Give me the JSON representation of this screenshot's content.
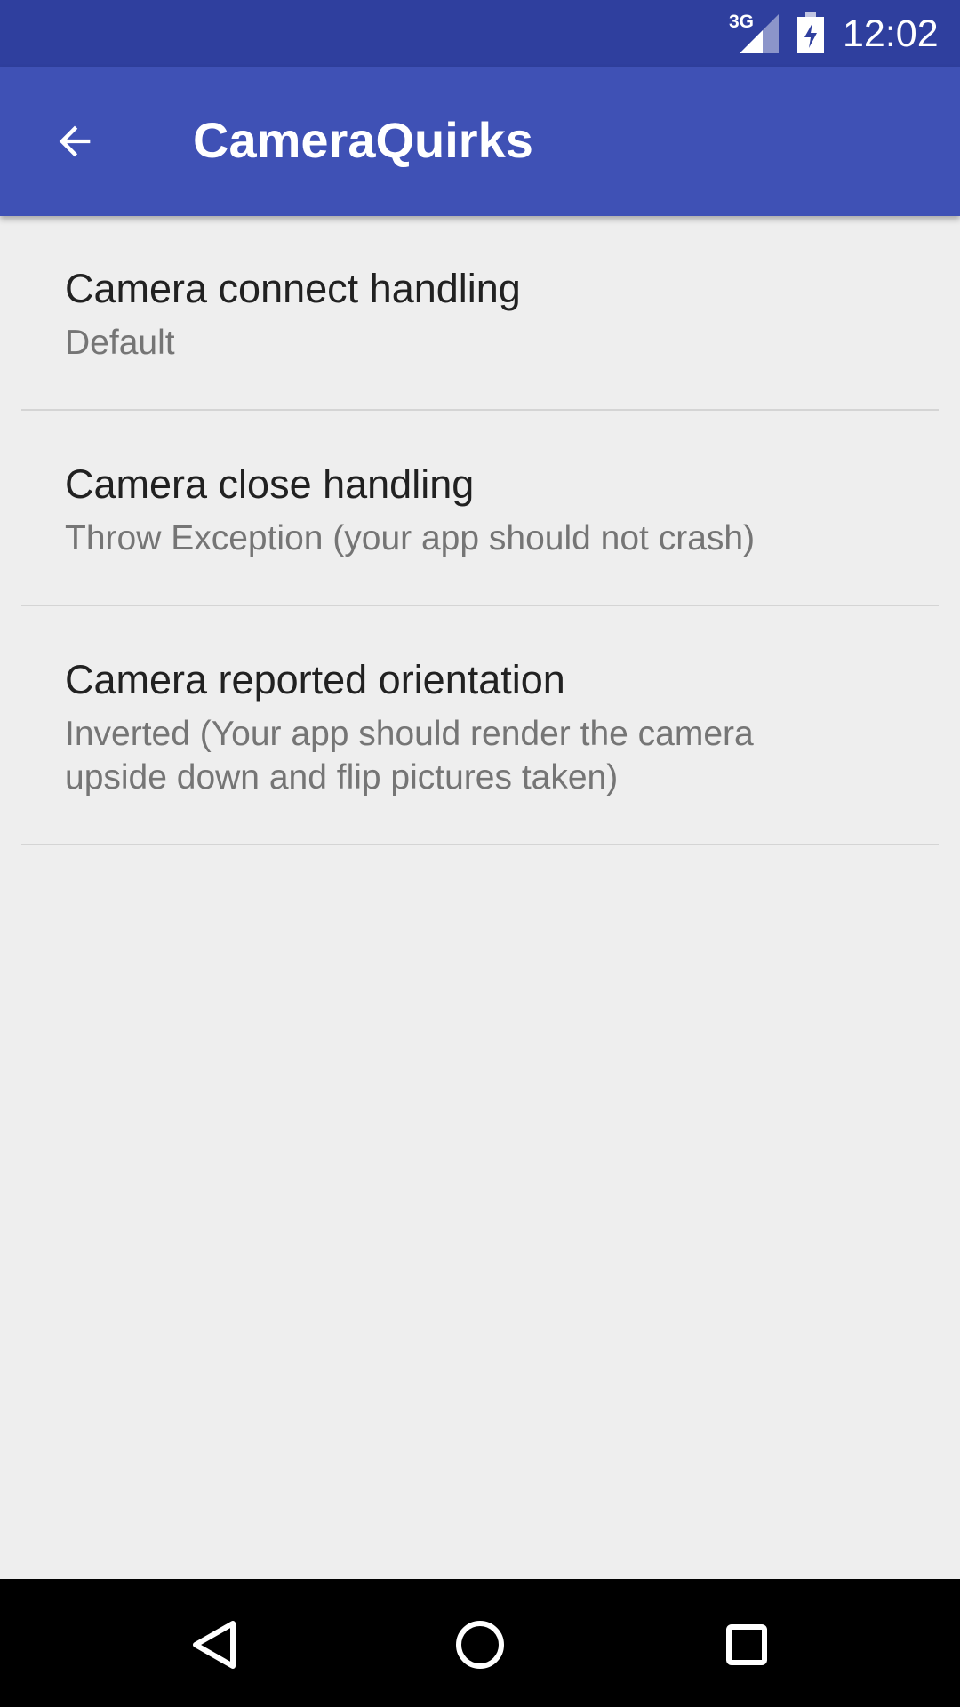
{
  "status_bar": {
    "network": "3G",
    "time": "12:02",
    "icons": [
      "network-3g-icon",
      "signal-icon",
      "battery-charging-icon"
    ]
  },
  "app_bar": {
    "title": "CameraQuirks",
    "back_icon": "arrow-back-icon"
  },
  "preferences": [
    {
      "title": "Camera connect handling",
      "summary": "Default"
    },
    {
      "title": "Camera close handling",
      "summary": "Throw Exception (your app should not crash)"
    },
    {
      "title": "Camera reported orientation",
      "summary": "Inverted (Your app should render the camera upside down and flip pictures taken)"
    }
  ],
  "nav_bar": {
    "icons": [
      "back-triangle-icon",
      "home-circle-icon",
      "recents-square-icon"
    ]
  },
  "colors": {
    "status_bar": "#2f3f9e",
    "app_bar": "#3f51b5",
    "background": "#eeeeee",
    "title_text": "#212121",
    "summary_text": "#757575"
  }
}
